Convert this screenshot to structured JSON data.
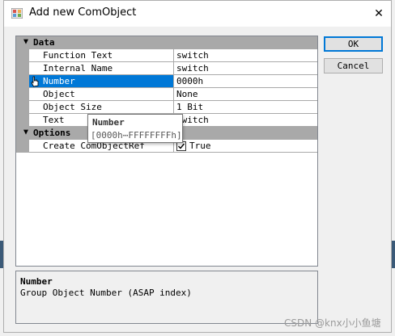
{
  "window": {
    "title": "Add new ComObject",
    "close_glyph": "✕"
  },
  "buttons": {
    "ok_label": "OK",
    "cancel_label": "Cancel"
  },
  "property_grid": {
    "categories": [
      {
        "glyph": "▲",
        "label": "Data"
      },
      {
        "glyph": "▲",
        "label": "Options"
      }
    ],
    "data_rows": [
      {
        "name": "Function Text",
        "value": "switch"
      },
      {
        "name": "Internal Name",
        "value": "switch"
      },
      {
        "name": "Number",
        "value": "0000h",
        "selected": true
      },
      {
        "name": "Object",
        "value": "None"
      },
      {
        "name": "Object Size",
        "value": "1 Bit"
      },
      {
        "name": "Text",
        "value": "switch"
      }
    ],
    "option_rows": [
      {
        "name": "Create ComObjectRef",
        "value": "True",
        "checked": true
      }
    ]
  },
  "tooltip": {
    "title": "Number",
    "range": "[0000h⋯FFFFFFFFh]"
  },
  "description": {
    "title": "Number",
    "text": "Group Object Number (ASAP index)"
  },
  "watermark": "CSDN @knx小小鱼塘",
  "colors": {
    "selection": "#0078d7",
    "category_bg": "#a9a9a9",
    "ok_border": "#0078d7"
  }
}
